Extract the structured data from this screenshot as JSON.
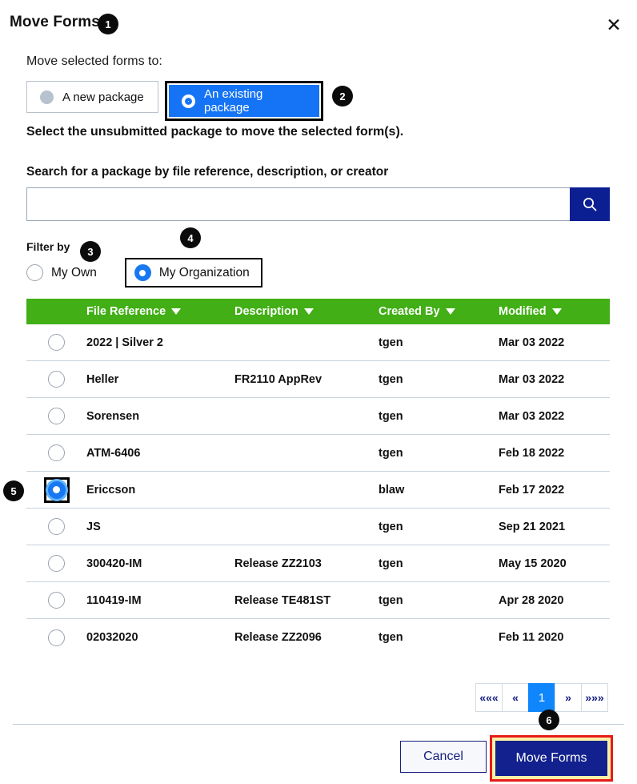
{
  "dialog": {
    "title": "Move Forms",
    "close_icon": "close-icon"
  },
  "badges": {
    "b1": "1",
    "b2": "2",
    "b3": "3",
    "b4": "4",
    "b5": "5",
    "b6": "6"
  },
  "labels": {
    "move_to": "Move selected forms to:",
    "select_package": "Select the unsubmitted package to move the selected form(s).",
    "search_label": "Search for a package by file reference, description, or creator",
    "filter_by": "Filter by"
  },
  "destination_toggle": {
    "new_package": "A new package",
    "existing_package": "An existing package",
    "selected": "An existing package"
  },
  "search": {
    "value": "",
    "placeholder": "",
    "button_icon": "search-icon"
  },
  "filter": {
    "my_own": "My Own",
    "my_organization": "My Organization",
    "selected": "My Organization"
  },
  "table": {
    "columns": [
      "File Reference",
      "Description",
      "Created By",
      "Modified"
    ],
    "sort_icon": "caret-down-icon",
    "rows": [
      {
        "selected": false,
        "file_reference": "2022 | Silver 2",
        "description": "",
        "created_by": "tgen",
        "modified": "Mar 03 2022"
      },
      {
        "selected": false,
        "file_reference": "Heller",
        "description": "FR2110 AppRev",
        "created_by": "tgen",
        "modified": "Mar 03 2022"
      },
      {
        "selected": false,
        "file_reference": "Sorensen",
        "description": "",
        "created_by": "tgen",
        "modified": "Mar 03 2022"
      },
      {
        "selected": false,
        "file_reference": "ATM-6406",
        "description": "",
        "created_by": "tgen",
        "modified": "Feb 18 2022"
      },
      {
        "selected": true,
        "file_reference": "Ericcson",
        "description": "",
        "created_by": "blaw",
        "modified": "Feb 17 2022"
      },
      {
        "selected": false,
        "file_reference": "JS",
        "description": "",
        "created_by": "tgen",
        "modified": "Sep 21 2021"
      },
      {
        "selected": false,
        "file_reference": "300420-IM",
        "description": "Release ZZ2103",
        "created_by": "tgen",
        "modified": "May 15 2020"
      },
      {
        "selected": false,
        "file_reference": "110419-IM",
        "description": "Release TE481ST",
        "created_by": "tgen",
        "modified": "Apr 28 2020"
      },
      {
        "selected": false,
        "file_reference": "02032020",
        "description": "Release ZZ2096",
        "created_by": "tgen",
        "modified": "Feb 11 2020"
      }
    ]
  },
  "pagination": {
    "first": "«««",
    "prev": "«",
    "current_page": "1",
    "next": "»",
    "last": "»»»"
  },
  "footer": {
    "cancel": "Cancel",
    "move_forms": "Move Forms"
  },
  "colors": {
    "accent_blue": "#1574f5",
    "navy": "#12218d",
    "table_header_green": "#41af15",
    "highlight_red": "#e81b16",
    "highlight_yellow": "#f8f1a8"
  }
}
